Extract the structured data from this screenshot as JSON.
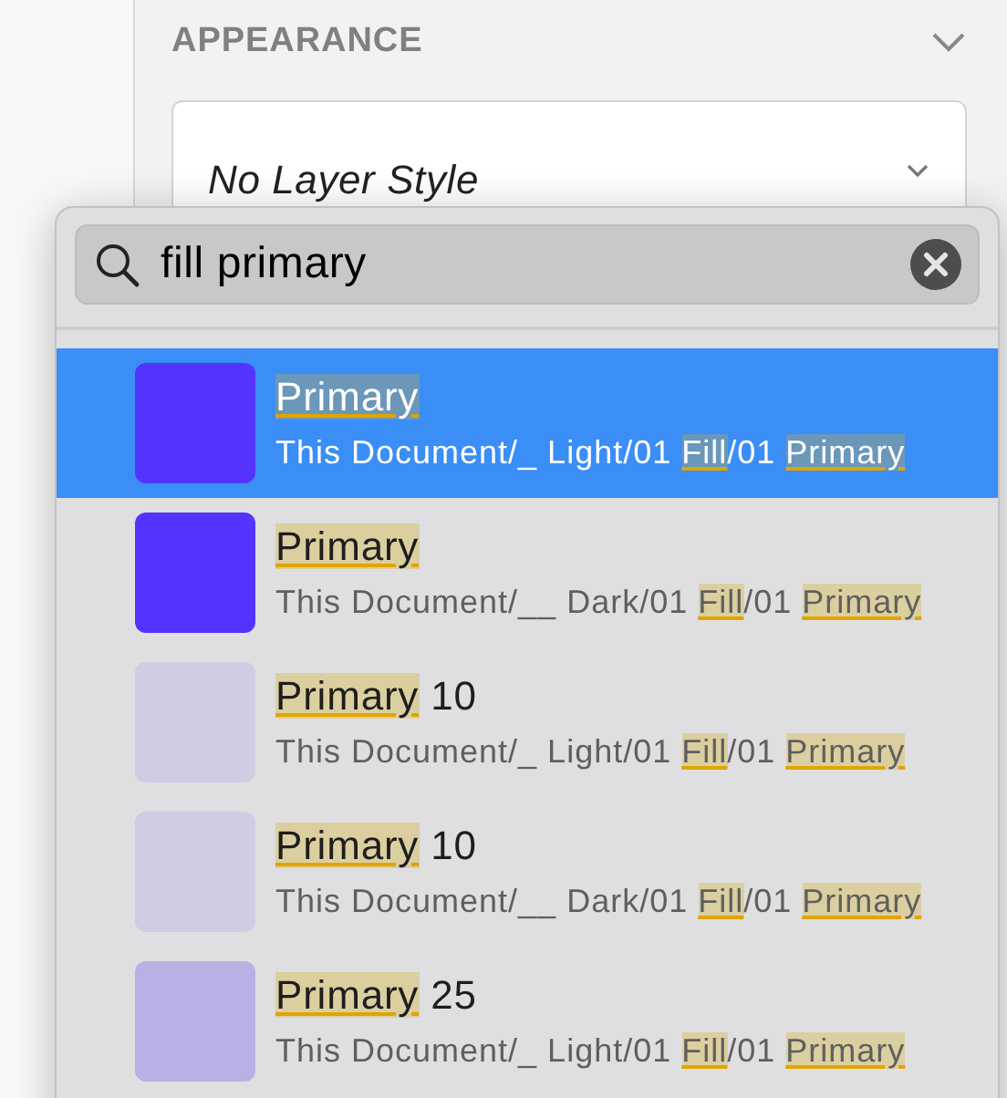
{
  "section": {
    "title": "APPEARANCE",
    "expanded": true
  },
  "layer_style": {
    "value": "No Layer Style"
  },
  "popup": {
    "search": {
      "value": "fill primary"
    },
    "results": [
      {
        "selected": true,
        "color": "#5433ff",
        "title": [
          {
            "text": "Primary",
            "match": true
          }
        ],
        "path": [
          {
            "text": "This Document/_ Light/01 ",
            "match": false
          },
          {
            "text": "Fill",
            "match": true
          },
          {
            "text": "/01 ",
            "match": false
          },
          {
            "text": "Primary",
            "match": true
          }
        ]
      },
      {
        "selected": false,
        "color": "#5433ff",
        "title": [
          {
            "text": "Primary",
            "match": true
          }
        ],
        "path": [
          {
            "text": "This Document/__ Dark/01 ",
            "match": false
          },
          {
            "text": "Fill",
            "match": true
          },
          {
            "text": "/01 ",
            "match": false
          },
          {
            "text": "Primary",
            "match": true
          }
        ]
      },
      {
        "selected": false,
        "color": "#cfcce3",
        "title": [
          {
            "text": "Primary",
            "match": true
          },
          {
            "text": " 10",
            "match": false
          }
        ],
        "path": [
          {
            "text": "This Document/_ Light/01 ",
            "match": false
          },
          {
            "text": "Fill",
            "match": true
          },
          {
            "text": "/01 ",
            "match": false
          },
          {
            "text": "Primary",
            "match": true
          }
        ]
      },
      {
        "selected": false,
        "color": "#cfcce3",
        "title": [
          {
            "text": "Primary",
            "match": true
          },
          {
            "text": " 10",
            "match": false
          }
        ],
        "path": [
          {
            "text": "This Document/__ Dark/01 ",
            "match": false
          },
          {
            "text": "Fill",
            "match": true
          },
          {
            "text": "/01 ",
            "match": false
          },
          {
            "text": "Primary",
            "match": true
          }
        ]
      },
      {
        "selected": false,
        "color": "#b8b1e6",
        "title": [
          {
            "text": "Primary",
            "match": true
          },
          {
            "text": " 25",
            "match": false
          }
        ],
        "path": [
          {
            "text": "This Document/_ Light/01 ",
            "match": false
          },
          {
            "text": "Fill",
            "match": true
          },
          {
            "text": "/01 ",
            "match": false
          },
          {
            "text": "Primary",
            "match": true
          }
        ]
      }
    ]
  }
}
